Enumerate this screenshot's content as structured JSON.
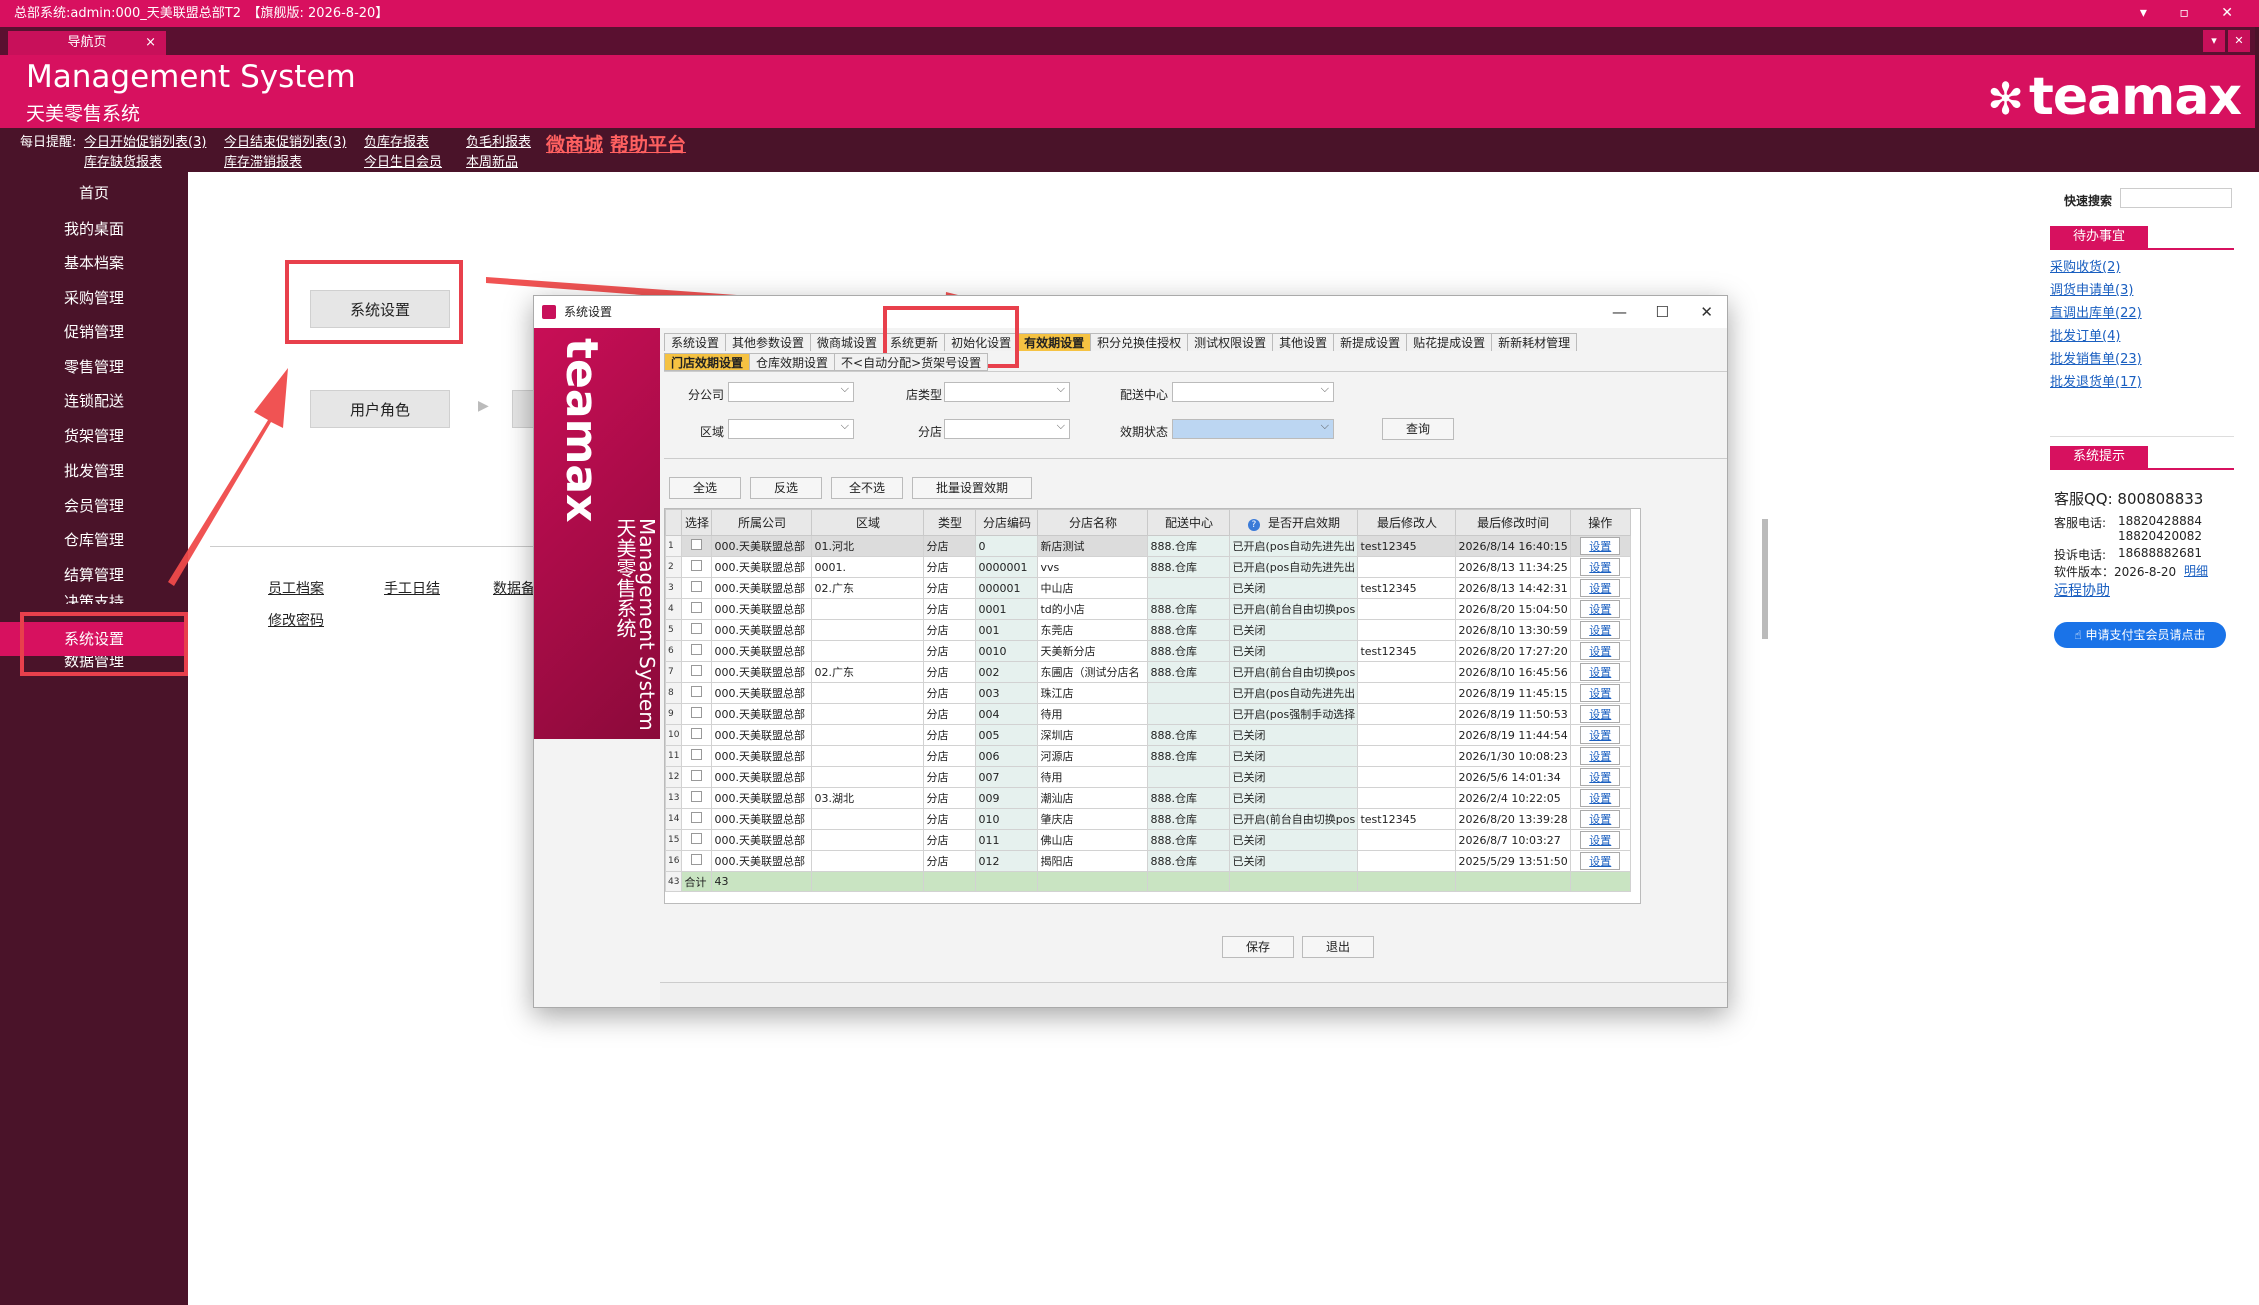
{
  "titlebar": {
    "text": "总部系统:admin:000_天美联盟总部T2　【旗舰版: 2026-8-20】",
    "controls": "▾ ▫ ✕"
  },
  "nav_tab": {
    "label": "导航页",
    "close": "×"
  },
  "tab_buttons": {
    "dropdown": "▾",
    "close": "✕"
  },
  "banner": {
    "title_en": "Management System",
    "title_cn": "天美零售系统",
    "logo": "teamax",
    "logo_icon": "flower-icon"
  },
  "reminder": {
    "label": "每日提醒:",
    "links": [
      "今日开始促销列表(3)",
      "今日结束促销列表(3)",
      "负库存报表",
      "负毛利报表",
      "库存缺货报表",
      "库存滞销报表",
      "今日生日会员",
      "本周新品"
    ],
    "highlight": [
      "微商城",
      "帮助平台"
    ]
  },
  "sidebar": {
    "items": [
      "首页",
      "我的桌面",
      "基本档案",
      "采购管理",
      "促销管理",
      "零售管理",
      "连锁配送",
      "货架管理",
      "批发管理",
      "会员管理",
      "仓库管理",
      "结算管理",
      "决策支持",
      "系统设置",
      "数据管理"
    ],
    "active_index": 13
  },
  "main": {
    "buttons": [
      "系统设置",
      "用户角色"
    ],
    "links": [
      "员工档案",
      "手工日结",
      "数据备",
      "修改密码"
    ]
  },
  "right_panel": {
    "search_label": "快速搜索",
    "todo_title": "待办事宜",
    "todo_items": [
      "采购收货(2)",
      "调货申请单(3)",
      "直调出库单(22)",
      "批发订单(4)",
      "批发销售单(23)",
      "批发退货单(17)"
    ],
    "tips_title": "系统提示",
    "qq": "客服QQ:  800808833",
    "phone_label": "客服电话:",
    "phone1": "18820428884",
    "phone2": "18820420082",
    "complaint_label": "投诉电话:",
    "complaint": "18688882681",
    "version_label": "软件版本：2026-8-20",
    "version_link": "明细",
    "remote": "远程协助",
    "apply_btn": "申请支付宝会员请点击"
  },
  "dialog": {
    "title": "系统设置",
    "window_buttons": [
      "—",
      "☐",
      "✕"
    ],
    "brand_en": "teamax",
    "brand_sub": "Management System 天美零售系统",
    "tabs1": [
      "系统设置",
      "其他参数设置",
      "微商城设置",
      "系统更新",
      "初始化设置",
      "有效期设置",
      "积分兑换佳授权",
      "测试权限设置",
      "其他设置",
      "新提成设置",
      "贴花提成设置",
      "新新耗材管理"
    ],
    "tabs1_active": 5,
    "tabs2": [
      "门店效期设置",
      "仓库效期设置",
      "不<自动分配>货架号设置"
    ],
    "tabs2_active": 0,
    "filters": {
      "branch_company": "分公司",
      "store_type": "店类型",
      "dc": "配送中心",
      "region": "区域",
      "store": "分店",
      "status": "效期状态",
      "query": "查询"
    },
    "actions": [
      "全选",
      "反选",
      "全不选",
      "批量设置效期"
    ],
    "columns": [
      "选择",
      "所属公司",
      "区域",
      "类型",
      "分店编码",
      "分店名称",
      "配送中心",
      "是否开启效期",
      "最后修改人",
      "最后修改时间",
      "操作"
    ],
    "help_icon": "?",
    "rows": [
      [
        "1",
        "000.天美联盟总部",
        "01.河北",
        "分店",
        "0",
        "新店测试",
        "888.仓库",
        "已开启(pos自动先进先出",
        "test12345",
        "2026/8/14 16:40:15",
        "设置"
      ],
      [
        "2",
        "000.天美联盟总部",
        "0001.",
        "分店",
        "0000001",
        "vvs",
        "888.仓库",
        "已开启(pos自动先进先出",
        "",
        "2026/8/13 11:34:25",
        "设置"
      ],
      [
        "3",
        "000.天美联盟总部",
        "02.广东",
        "分店",
        "000001",
        "中山店",
        "",
        "已关闭",
        "test12345",
        "2026/8/13 14:42:31",
        "设置"
      ],
      [
        "4",
        "000.天美联盟总部",
        "",
        "分店",
        "0001",
        "td的小店",
        "888.仓库",
        "已开启(前台自由切换pos",
        "",
        "2026/8/20 15:04:50",
        "设置"
      ],
      [
        "5",
        "000.天美联盟总部",
        "",
        "分店",
        "001",
        "东莞店",
        "888.仓库",
        "已关闭",
        "",
        "2026/8/10 13:30:59",
        "设置"
      ],
      [
        "6",
        "000.天美联盟总部",
        "",
        "分店",
        "0010",
        "天美新分店",
        "888.仓库",
        "已关闭",
        "test12345",
        "2026/8/20 17:27:20",
        "设置"
      ],
      [
        "7",
        "000.天美联盟总部",
        "02.广东",
        "分店",
        "002",
        "东圃店（测试分店名",
        "888.仓库",
        "已开启(前台自由切换pos",
        "",
        "2026/8/10 16:45:56",
        "设置"
      ],
      [
        "8",
        "000.天美联盟总部",
        "",
        "分店",
        "003",
        "珠江店",
        "",
        "已开启(pos自动先进先出",
        "",
        "2026/8/19 11:45:15",
        "设置"
      ],
      [
        "9",
        "000.天美联盟总部",
        "",
        "分店",
        "004",
        "待用",
        "",
        "已开启(pos强制手动选择",
        "",
        "2026/8/19 11:50:53",
        "设置"
      ],
      [
        "10",
        "000.天美联盟总部",
        "",
        "分店",
        "005",
        "深圳店",
        "888.仓库",
        "已关闭",
        "",
        "2026/8/19 11:44:54",
        "设置"
      ],
      [
        "11",
        "000.天美联盟总部",
        "",
        "分店",
        "006",
        "河源店",
        "888.仓库",
        "已关闭",
        "",
        "2026/1/30 10:08:23",
        "设置"
      ],
      [
        "12",
        "000.天美联盟总部",
        "",
        "分店",
        "007",
        "待用",
        "",
        "已关闭",
        "",
        "2026/5/6 14:01:34",
        "设置"
      ],
      [
        "13",
        "000.天美联盟总部",
        "03.湖北",
        "分店",
        "009",
        "潮汕店",
        "888.仓库",
        "已关闭",
        "",
        "2026/2/4 10:22:05",
        "设置"
      ],
      [
        "14",
        "000.天美联盟总部",
        "",
        "分店",
        "010",
        "肇庆店",
        "888.仓库",
        "已开启(前台自由切换pos",
        "test12345",
        "2026/8/20 13:39:28",
        "设置"
      ],
      [
        "15",
        "000.天美联盟总部",
        "",
        "分店",
        "011",
        "佛山店",
        "888.仓库",
        "已关闭",
        "",
        "2026/8/7 10:03:27",
        "设置"
      ],
      [
        "16",
        "000.天美联盟总部",
        "",
        "分店",
        "012",
        "揭阳店",
        "888.仓库",
        "已关闭",
        "",
        "2025/5/29 13:51:50",
        "设置"
      ]
    ],
    "summary": {
      "row_no": "43",
      "label": "合计",
      "count": "43"
    },
    "save": "保存",
    "exit": "退出"
  }
}
